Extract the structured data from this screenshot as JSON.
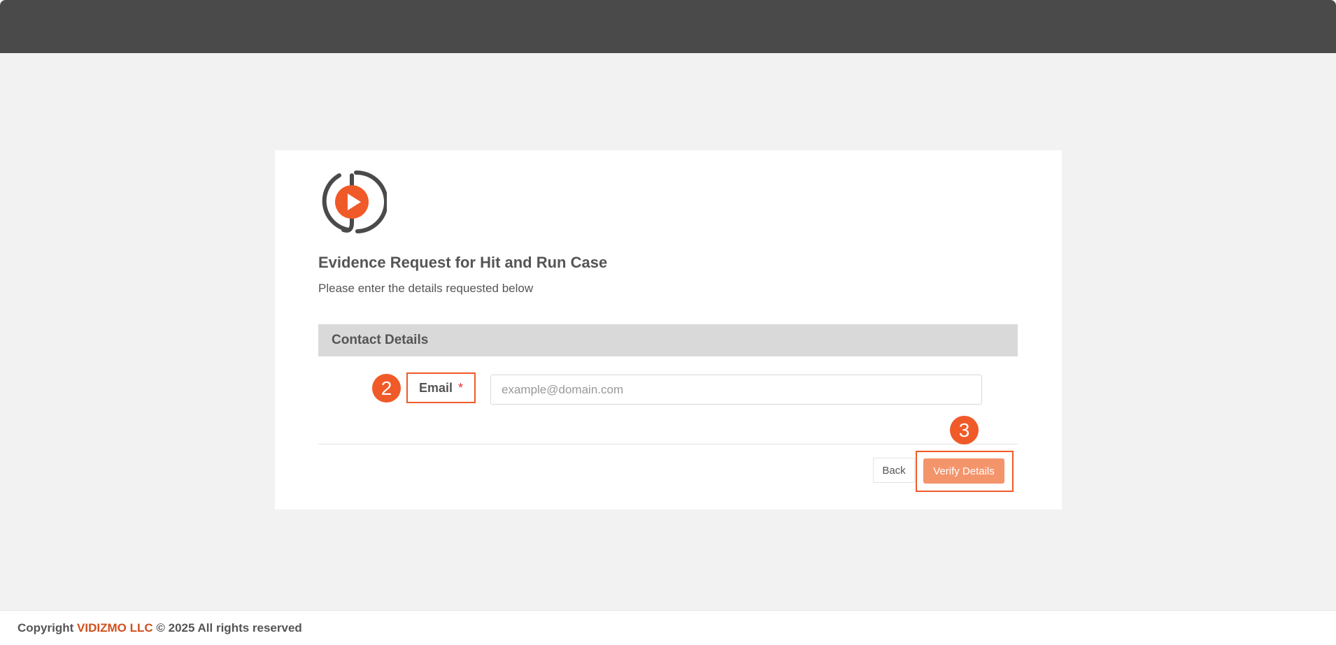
{
  "form": {
    "title": "Evidence Request for Hit and Run Case",
    "subtitle": "Please enter the details requested below",
    "section_title": "Contact Details",
    "email_label": "Email",
    "required_marker": "*",
    "email_placeholder": "example@domain.com",
    "email_value": "",
    "back_label": "Back",
    "verify_label": "Verify Details"
  },
  "annotations": {
    "step_email": "2",
    "step_verify": "3",
    "highlight_color": "#f05a28"
  },
  "footer": {
    "prefix": "Copyright",
    "company": "VIDIZMO LLC",
    "suffix": "© 2025 All rights reserved"
  },
  "colors": {
    "topbar": "#4a4a4a",
    "accent": "#f05a28",
    "verify_button": "#f4946b",
    "brand_text": "#d2501e"
  },
  "icons": {
    "logo": "vidizmo-play-logo-icon"
  }
}
